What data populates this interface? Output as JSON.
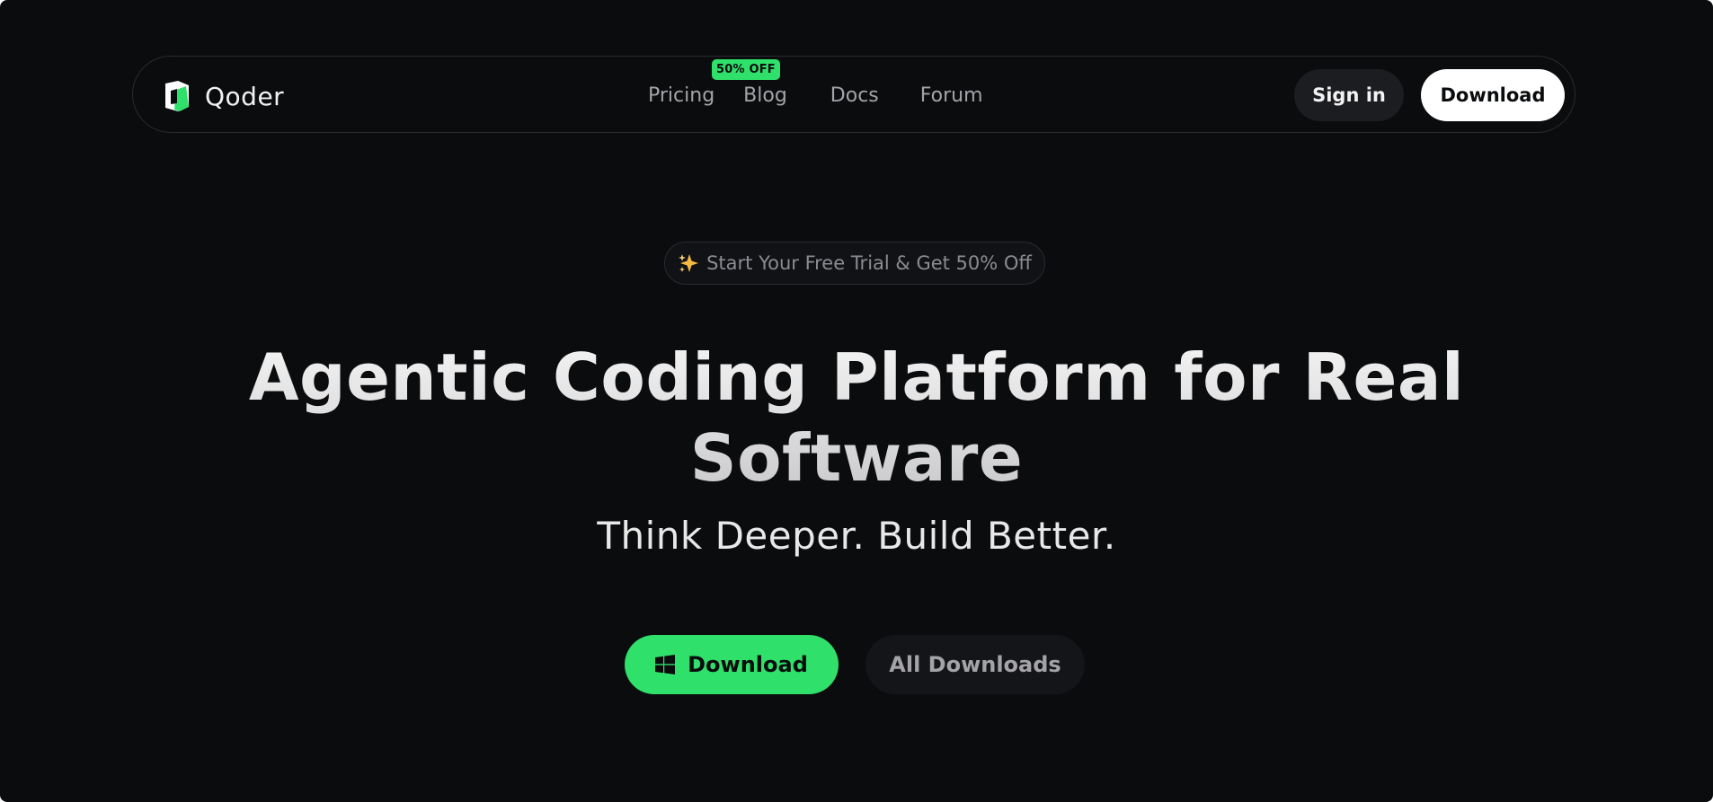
{
  "brand": {
    "name": "Qoder",
    "icon": "qoder-logo-icon",
    "accent_color": "#2fe06a"
  },
  "nav": {
    "links": [
      {
        "label": "Pricing",
        "badge": "50% OFF"
      },
      {
        "label": "Blog"
      },
      {
        "label": "Docs"
      },
      {
        "label": "Forum"
      }
    ],
    "sign_in_label": "Sign in",
    "download_label": "Download"
  },
  "hero": {
    "promo_icon": "sparkle-icon",
    "promo_text": "Start Your Free Trial & Get 50% Off",
    "title": "Agentic Coding Platform for Real Software",
    "subtitle": "Think Deeper. Build Better.",
    "primary_cta": {
      "label": "Download",
      "icon": "windows-icon"
    },
    "secondary_cta": {
      "label": "All Downloads"
    }
  },
  "colors": {
    "background": "#0b0c0e",
    "primary_button": "#2fe06a",
    "nav_download_button": "#ffffff"
  }
}
